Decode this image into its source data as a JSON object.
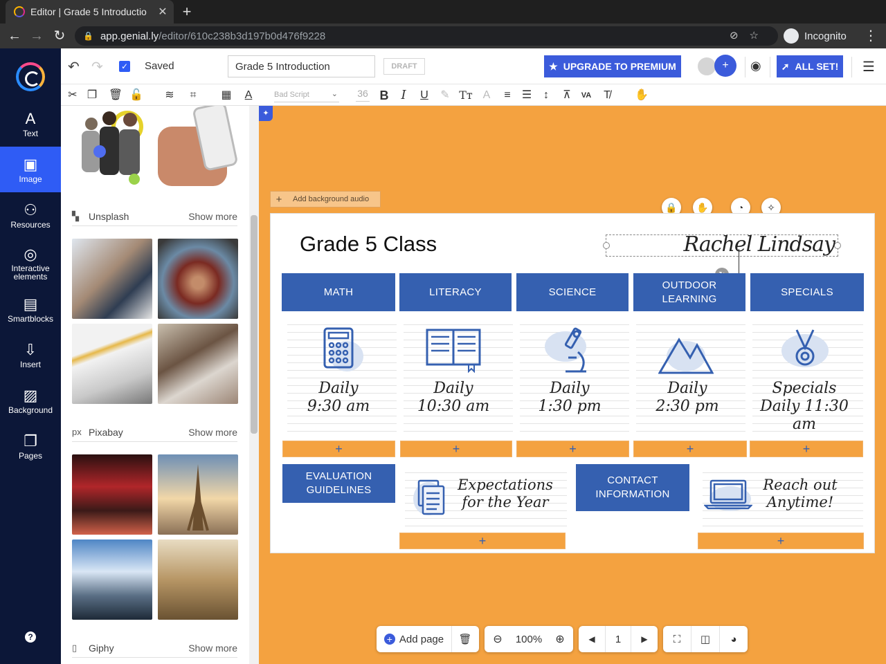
{
  "browser": {
    "tab_title": "Editor | Grade 5 Introductio",
    "tab_close": "✕",
    "new_tab": "+",
    "url_host": "app.genial.ly",
    "url_path": "/editor/610c238b3d197b0d476f9228",
    "incognito_label": "Incognito"
  },
  "rail": {
    "items": [
      {
        "label": "Text",
        "icon": "A"
      },
      {
        "label": "Image",
        "icon": "▣"
      },
      {
        "label": "Resources",
        "icon": "⚇"
      },
      {
        "label": "Interactive elements",
        "icon": "◎"
      },
      {
        "label": "Smartblocks",
        "icon": "▤"
      },
      {
        "label": "Insert",
        "icon": "⇩"
      },
      {
        "label": "Background",
        "icon": "▨"
      },
      {
        "label": "Pages",
        "icon": "❐"
      }
    ],
    "active_index": 1,
    "help": "?"
  },
  "topbar": {
    "saved_label": "Saved",
    "title_value": "Grade 5 Introduction",
    "draft_badge": "DRAFT",
    "upgrade_label": "UPGRADE TO PREMIUM",
    "allset_label": "ALL SET!"
  },
  "format": {
    "font_name": "Bad Script",
    "font_size": "36"
  },
  "library": {
    "sections": [
      {
        "name": "Unsplash",
        "more": "Show more"
      },
      {
        "name": "Pixabay",
        "more": "Show more"
      },
      {
        "name": "Giphy",
        "more": "Show more"
      }
    ],
    "pixabay_prefix": "px"
  },
  "canvas": {
    "bg_audio_label": "Add background audio",
    "title": "Grade 5 Class",
    "teacher": "Rachel Lindsay",
    "subjects": [
      "MATH",
      "LITERACY",
      "SCIENCE",
      "OUTDOOR LEARNING",
      "SPECIALS"
    ],
    "schedules": [
      {
        "line1": "Daily",
        "line2": "9:30 am",
        "icon": "calculator-icon"
      },
      {
        "line1": "Daily",
        "line2": "10:30 am",
        "icon": "book-icon"
      },
      {
        "line1": "Daily",
        "line2": "1:30 pm",
        "icon": "microscope-icon"
      },
      {
        "line1": "Daily",
        "line2": "2:30 pm",
        "icon": "mountain-icon"
      },
      {
        "line1": "Specials",
        "line2": "Daily 11:30 am",
        "icon": "medal-icon"
      }
    ],
    "add_symbol": "+",
    "evaluation": "EVALUATION GUIDELINES",
    "expectations": "Expectations for the Year",
    "contact": "CONTACT INFORMATION",
    "reach_out": "Reach out Anytime!"
  },
  "bottom": {
    "add_page": "Add page",
    "zoom": "100%",
    "page_number": "1"
  },
  "colors": {
    "accent": "#3b5bdb",
    "rail_bg": "#0c1738",
    "stage_bg": "#f4a240",
    "subject_blue": "#3560b0"
  }
}
